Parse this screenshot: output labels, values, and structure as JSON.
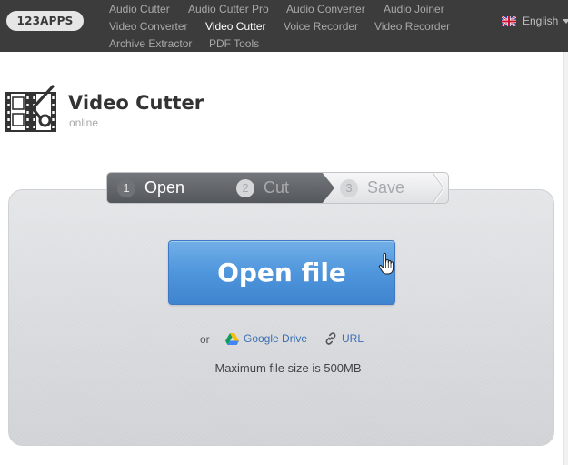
{
  "topbar": {
    "logo": "123APPS",
    "nav": [
      {
        "label": "Audio Cutter",
        "active": false
      },
      {
        "label": "Audio Cutter Pro",
        "active": false
      },
      {
        "label": "Audio Converter",
        "active": false
      },
      {
        "label": "Audio Joiner",
        "active": false
      },
      {
        "label": "Video Converter",
        "active": false
      },
      {
        "label": "Video Cutter",
        "active": true
      },
      {
        "label": "Voice Recorder",
        "active": false
      },
      {
        "label": "Video Recorder",
        "active": false
      },
      {
        "label": "Archive Extractor",
        "active": false
      },
      {
        "label": "PDF Tools",
        "active": false
      }
    ],
    "language": "English"
  },
  "header": {
    "title": "Video Cutter",
    "subtitle": "online",
    "icon": "film-scissors-icon"
  },
  "steps": [
    {
      "number": "1",
      "label": "Open",
      "active": true
    },
    {
      "number": "2",
      "label": "Cut",
      "active": false
    },
    {
      "number": "3",
      "label": "Save",
      "active": false
    }
  ],
  "upload": {
    "button_label": "Open file",
    "or_text": "or",
    "google_drive_label": "Google Drive",
    "url_label": "URL",
    "max_size_text": "Maximum file size is 500MB"
  },
  "colors": {
    "topbar_bg": "#3c3c3c",
    "active_step": "#5d6166",
    "button_blue": "#4f96dc",
    "link_blue": "#3b6fb6"
  }
}
